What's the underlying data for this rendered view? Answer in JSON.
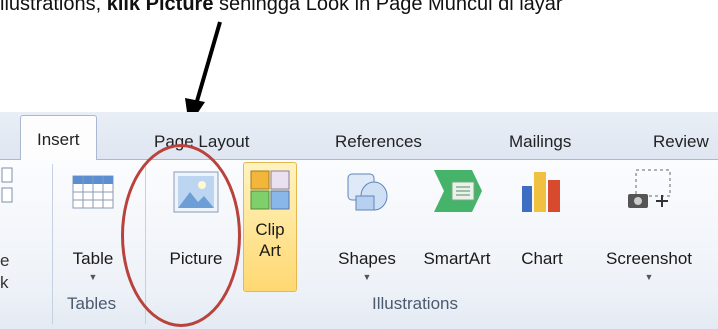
{
  "instruction": {
    "prefix": "llustrations, ",
    "bold": "klik Picture",
    "suffix": " sehingga Look in Page Muncul di layar"
  },
  "tabs": [
    {
      "label": "Insert",
      "active": true
    },
    {
      "label": "Page Layout",
      "active": false
    },
    {
      "label": "References",
      "active": false
    },
    {
      "label": "Mailings",
      "active": false
    },
    {
      "label": "Review",
      "active": false
    }
  ],
  "left_cut_text": [
    "e",
    "k"
  ],
  "groups": {
    "tables": {
      "label": "Tables",
      "table_button": {
        "label": "Table",
        "icon": "table-icon"
      }
    },
    "illustrations": {
      "label": "Illustrations",
      "buttons": [
        {
          "label": "Picture",
          "icon": "picture-icon"
        },
        {
          "label": "Clip Art",
          "line1": "Clip",
          "line2": "Art",
          "icon": "clip-art-icon",
          "highlighted": true
        },
        {
          "label": "Shapes",
          "icon": "shapes-icon",
          "dropdown": true
        },
        {
          "label": "SmartArt",
          "icon": "smartart-icon"
        },
        {
          "label": "Chart",
          "icon": "chart-icon"
        },
        {
          "label": "Screenshot",
          "icon": "screenshot-icon",
          "dropdown": true
        }
      ]
    }
  },
  "annotation": {
    "circle_color": "#b9423c",
    "arrow_color": "#000000"
  },
  "colors": {
    "ribbon_background": "#eef2f8",
    "highlight": "#ffd872",
    "tab_border": "#aab9d1"
  }
}
